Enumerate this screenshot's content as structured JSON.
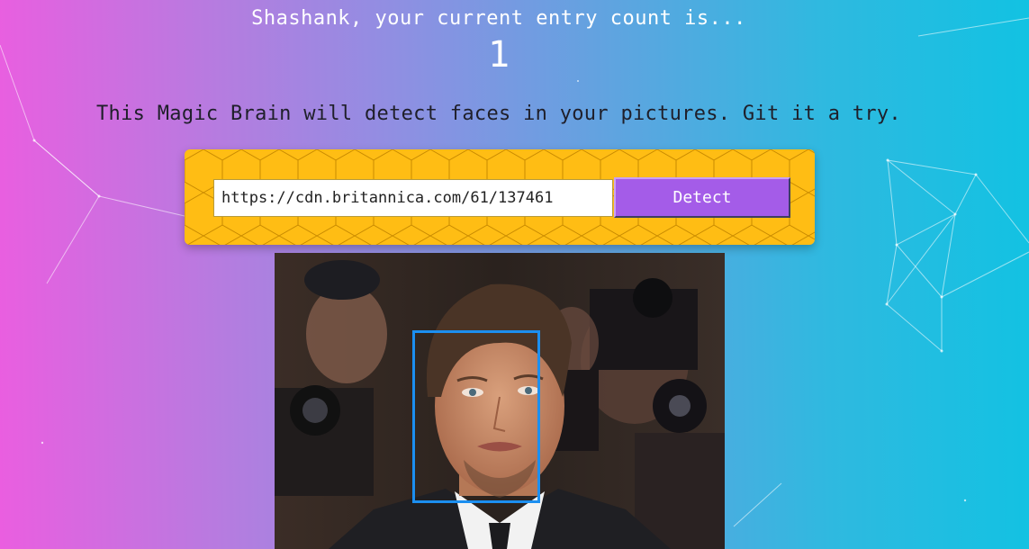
{
  "header": {
    "greeting": "Shashank, your current entry count is...",
    "entry_count": "1"
  },
  "intro": {
    "tagline": "This Magic Brain will detect faces in your pictures. Git it a try."
  },
  "form": {
    "image_url": "https://cdn.britannica.com/61/137461",
    "detect_label": "Detect"
  },
  "colors": {
    "gradient_left": "#ea5ee0",
    "gradient_right": "#12c2e2",
    "panel": "#ffbd14",
    "button": "#a45ce8",
    "face_box": "#1c8ff0"
  }
}
